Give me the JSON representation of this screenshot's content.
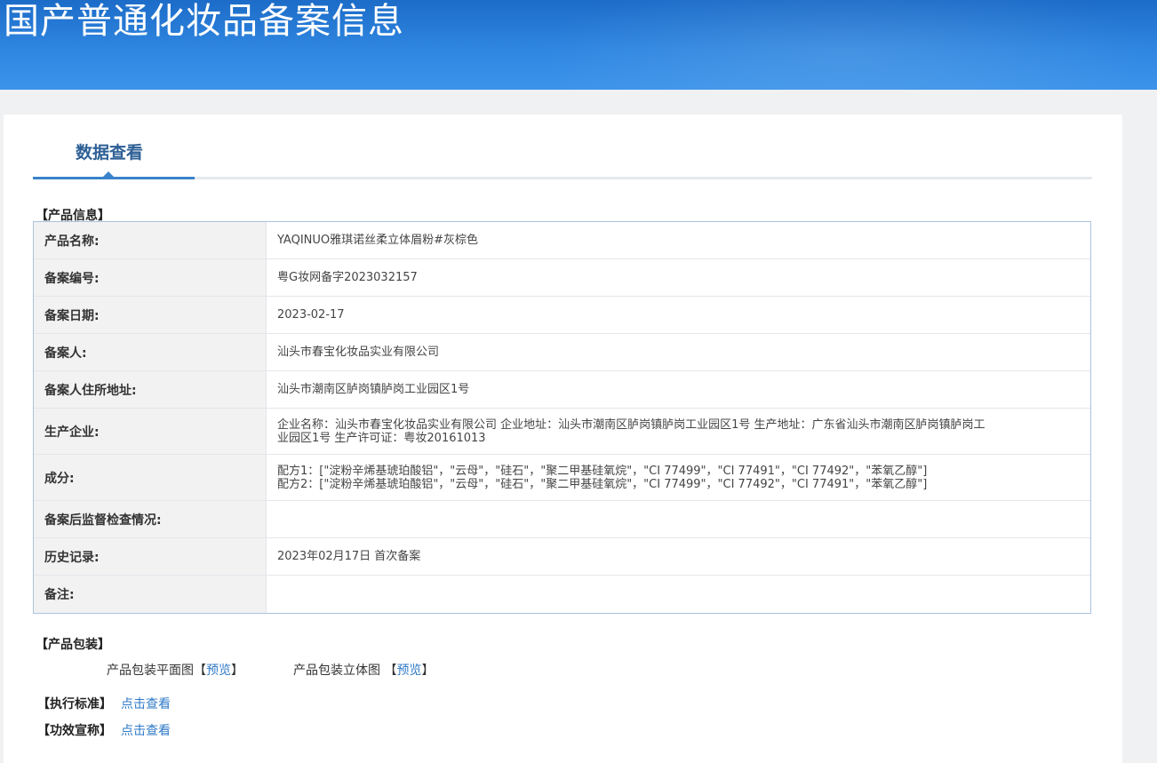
{
  "header": {
    "title": "国产普通化妆品备案信息"
  },
  "tabs": [
    {
      "label": "数据查看"
    }
  ],
  "product_info": {
    "section_title": "【产品信息】",
    "rows": [
      {
        "key": "产品名称:",
        "value": "YAQINUO雅琪诺丝柔立体眉粉#灰棕色"
      },
      {
        "key": "备案编号:",
        "value": "粤G妆网备字2023032157"
      },
      {
        "key": "备案日期:",
        "value": "2023-02-17"
      },
      {
        "key": "备案人:",
        "value": "汕头市春宝化妆品实业有限公司"
      },
      {
        "key": "备案人住所地址:",
        "value": "汕头市潮南区胪岗镇胪岗工业园区1号"
      },
      {
        "key": "生产企业:",
        "line1": "企业名称：汕头市春宝化妆品实业有限公司 企业地址：汕头市潮南区胪岗镇胪岗工业园区1号 生产地址：广东省汕头市潮南区胪岗镇胪岗工",
        "line2": "业园区1号 生产许可证：粤妆20161013"
      },
      {
        "key": "成分:",
        "line1": "配方1：[\"淀粉辛烯基琥珀酸铝\"，\"云母\"，\"硅石\"，\"聚二甲基硅氧烷\"，\"CI 77499\"，\"CI 77491\"，\"CI 77492\"，\"苯氧乙醇\"]",
        "line2": "配方2：[\"淀粉辛烯基琥珀酸铝\"，\"云母\"，\"硅石\"，\"聚二甲基硅氧烷\"，\"CI 77499\"，\"CI 77492\"，\"CI 77491\"，\"苯氧乙醇\"]"
      },
      {
        "key": "备案后监督检查情况:",
        "value": ""
      },
      {
        "key": "历史记录:",
        "value": "2023年02月17日 首次备案"
      },
      {
        "key": "备注:",
        "value": ""
      }
    ]
  },
  "packaging": {
    "section_title": "【产品包装】",
    "flat_label": "产品包装平面图",
    "flat_link": "预览",
    "solid_label": "产品包装立体图",
    "solid_link": "预览",
    "bracket_open": "【",
    "bracket_close": "】"
  },
  "standard": {
    "label": "【执行标准】",
    "link": "点击查看"
  },
  "efficacy": {
    "label": "【功效宣称】",
    "link": "点击查看"
  },
  "colors": {
    "banner": "#2f86e0",
    "accent": "#3a83cc",
    "link": "#2f7ac7"
  }
}
